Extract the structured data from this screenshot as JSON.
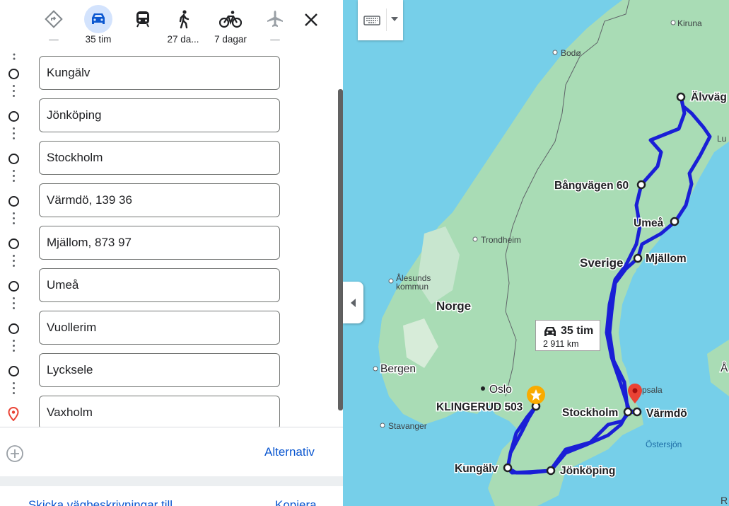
{
  "modes": [
    {
      "name": "best",
      "label": "—"
    },
    {
      "name": "car",
      "label": "35 tim"
    },
    {
      "name": "transit",
      "label": ""
    },
    {
      "name": "walk",
      "label": "27 da..."
    },
    {
      "name": "bike",
      "label": "7 dagar"
    },
    {
      "name": "flight",
      "label": "—"
    }
  ],
  "stops": [
    "Kungälv",
    "Jönköping",
    "Stockholm",
    "Värmdö, 139 36",
    "Mjällom, 873 97",
    "Umeå",
    "Vuollerim",
    "Lycksele",
    "Vaxholm"
  ],
  "actions": {
    "alternatives": "Alternativ",
    "send": "Skicka vägbeskrivningar till",
    "copy": "Kopiera"
  },
  "route": {
    "time": "35 tim",
    "distance": "2 911 km"
  },
  "map_labels": {
    "kiruna": "Kiruna",
    "bodo": "Bodø",
    "alvvag": "Älvväg",
    "lu": "Lu",
    "bangvagen": "Bångvägen 60",
    "umea": "Umeå",
    "sverige": "Sverige",
    "mjallom": "Mjällom",
    "trondheim": "Trondheim",
    "alesund1": "Ålesunds",
    "alesund2": "kommun",
    "norge": "Norge",
    "bergen": "Bergen",
    "oslo": "Oslo",
    "klingerud": "KLINGERUD 503",
    "uppsala": "psala",
    "stockholm": "Stockholm",
    "varmdo": "Värmdö",
    "stavanger": "Stavanger",
    "ostersjon": "Östersjön",
    "kungalv": "Kungälv",
    "jonkoping": "Jönköping",
    "a": "Å",
    "r": "R"
  },
  "colors": {
    "route": "#1a1fd6",
    "active": "#d3e3fd",
    "link": "#0b57d0",
    "water": "#76cfe9",
    "land": "#a9dcb5"
  }
}
